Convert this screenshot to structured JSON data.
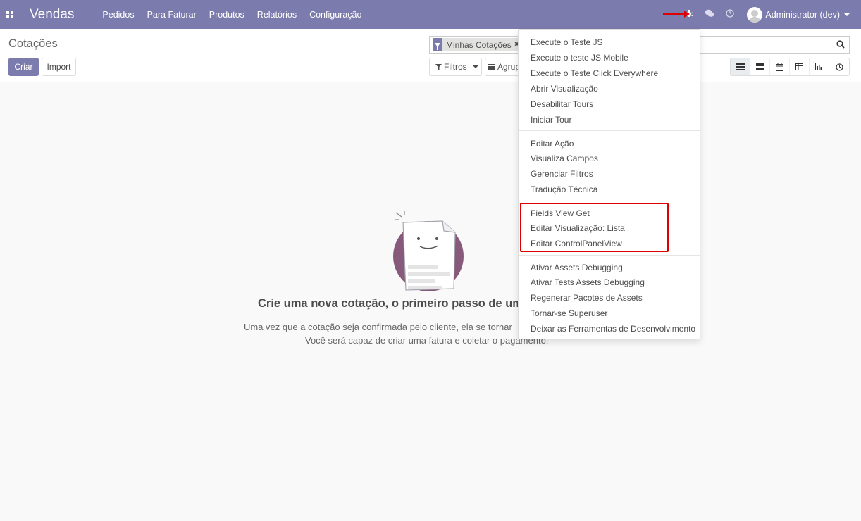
{
  "navbar": {
    "app_name": "Vendas",
    "menu": [
      "Pedidos",
      "Para Faturar",
      "Produtos",
      "Relatórios",
      "Configuração"
    ],
    "user": "Administrator (dev)"
  },
  "control_panel": {
    "breadcrumb": "Cotações",
    "create_label": "Criar",
    "import_label": "Import",
    "search_facet": "Minhas Cotações",
    "filters_label": "Filtros",
    "group_label": "Agrup"
  },
  "empty_state": {
    "title": "Crie uma nova cotação, o primeiro passo de um",
    "line1": "Uma vez que a cotação seja confirmada pelo cliente, ela se tornar",
    "line2": "Você será capaz de criar uma fatura e coletar o pagamento."
  },
  "debug_menu": {
    "section1": [
      "Execute o Teste JS",
      "Execute o teste JS Mobile",
      "Execute o Teste Click Everywhere",
      "Abrir Visualização",
      "Desabilitar Tours",
      "Iniciar Tour"
    ],
    "section2": [
      "Editar Ação",
      "Visualiza Campos",
      "Gerenciar Filtros",
      "Tradução Técnica"
    ],
    "section3": [
      "Fields View Get",
      "Editar Visualização: Lista",
      "Editar ControlPanelView"
    ],
    "section4": [
      "Ativar Assets Debugging",
      "Ativar Tests Assets Debugging",
      "Regenerar Pacotes de Assets",
      "Tornar-se Superuser",
      "Deixar as Ferramentas de Desenvolvimento"
    ]
  },
  "colors": {
    "brand": "#7c7bad",
    "annotation": "#dd0000"
  }
}
